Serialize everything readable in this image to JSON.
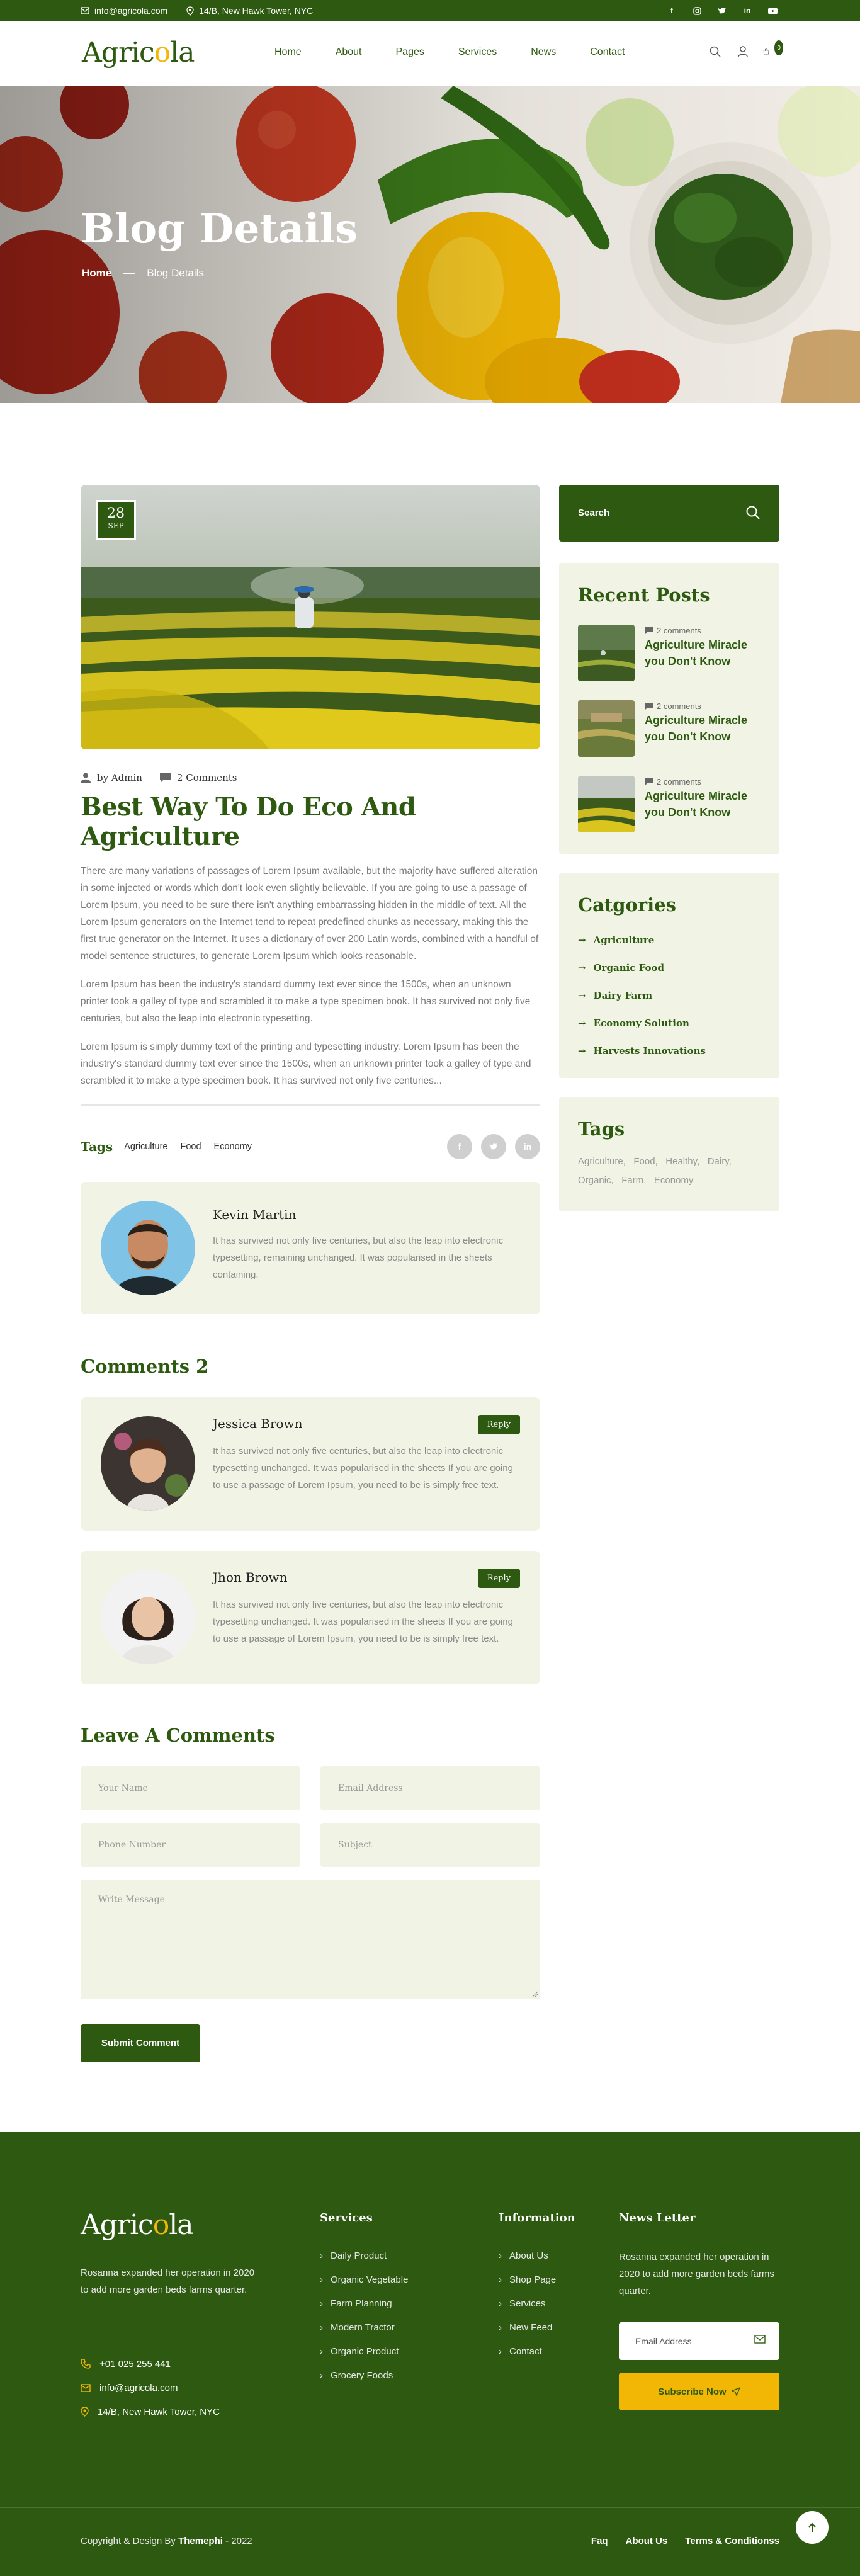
{
  "topbar": {
    "email": "info@agricola.com",
    "address": "14/B, New Hawk Tower, NYC",
    "social": [
      "facebook-icon",
      "instagram-icon",
      "twitter-icon",
      "linkedin-icon",
      "youtube-icon"
    ]
  },
  "header": {
    "logo_prefix": "Agric",
    "logo_o": "o",
    "logo_suffix": "la",
    "nav": [
      "Home",
      "About",
      "Pages",
      "Services",
      "News",
      "Contact"
    ],
    "cart_count": "0"
  },
  "hero": {
    "title": "Blog Details",
    "crumb_home": "Home",
    "crumb_current": "Blog Details"
  },
  "post": {
    "day": "28",
    "month": "SEP",
    "author": "by Admin",
    "comments": "2 Comments",
    "title": "Best Way To Do Eco And Agriculture",
    "paragraphs": [
      "There are many variations of passages of Lorem Ipsum available, but the majority have suffered alteration in some injected or words which don't look even slightly believable. If you are going to use a passage of Lorem Ipsum, you need to be sure there isn't anything embarrassing hidden in the middle of text. All the Lorem Ipsum generators on the Internet tend to repeat predefined chunks as necessary, making this the first true generator on the Internet. It uses a dictionary of over 200 Latin words, combined with a handful of model sentence structures, to generate Lorem Ipsum which looks reasonable.",
      "Lorem Ipsum has been the industry's standard dummy text ever since the 1500s, when an unknown printer took a galley of type and scrambled it to make a type specimen book. It has survived not only five centuries, but also the leap into electronic typesetting.",
      "Lorem Ipsum is simply dummy text of the printing and typesetting industry. Lorem Ipsum has been the industry's standard dummy text ever since the 1500s, when an unknown printer took a galley of type and scrambled it to make a type specimen book. It has survived not only five centuries..."
    ],
    "tags_label": "Tags",
    "tags": [
      "Agriculture",
      "Food",
      "Economy"
    ],
    "share": [
      "f",
      "t",
      "in"
    ]
  },
  "author_box": {
    "name": "Kevin Martin",
    "bio": "It has survived not only five centuries, but also the leap into electronic typesetting, remaining unchanged. It was popularised in the sheets containing."
  },
  "comments": {
    "heading": "Comments 2",
    "items": [
      {
        "name": "Jessica Brown",
        "reply": "Reply",
        "text": "It has survived not only five centuries, but also the leap into electronic typesetting unchanged. It was popularised in the sheets If you are going to use a passage of Lorem Ipsum, you need to be is simply free text."
      },
      {
        "name": "Jhon Brown",
        "reply": "Reply",
        "text": "It has survived not only five centuries, but also the leap into electronic typesetting unchanged. It was popularised in the sheets If you are going to use a passage of Lorem Ipsum, you need to be is simply free text."
      }
    ]
  },
  "form": {
    "heading": "Leave A Comments",
    "name_placeholder": "Your Name",
    "email_placeholder": "Email Address",
    "phone_placeholder": "Phone Number",
    "subject_placeholder": "Subject",
    "message_placeholder": "Write Message",
    "submit": "Submit Comment"
  },
  "sidebar": {
    "search_label": "Search",
    "recent_heading": "Recent Posts",
    "recent": [
      {
        "comments": "2 comments",
        "title": "Agriculture Miracle you Don't Know"
      },
      {
        "comments": "2 comments",
        "title": "Agriculture Miracle you Don't Know"
      },
      {
        "comments": "2 comments",
        "title": "Agriculture Miracle you Don't Know"
      }
    ],
    "categories_heading": "Catgories",
    "categories": [
      "Agriculture",
      "Organic Food",
      "Dairy Farm",
      "Economy Solution",
      "Harvests Innovations"
    ],
    "tags_heading": "Tags",
    "tags": [
      "Agriculture,",
      "Food,",
      "Healthy,",
      "Dairy,",
      "Organic,",
      "Farm,",
      "Economy"
    ]
  },
  "footer": {
    "desc": "Rosanna expanded her operation in 2020 to add more garden beds farms quarter.",
    "phone": "+01 025 255 441",
    "email": "info@agricola.com",
    "address": "14/B, New Hawk Tower, NYC",
    "services_heading": "Services",
    "services": [
      "Daily Product",
      "Organic Vegetable",
      "Farm Planning",
      "Modern Tractor",
      "Organic Product",
      "Grocery Foods"
    ],
    "info_heading": "Information",
    "info": [
      "About Us",
      "Shop Page",
      "Services",
      "New Feed",
      "Contact"
    ],
    "news_heading": "News Letter",
    "news_desc": "Rosanna expanded her operation in 2020 to add more garden beds farms quarter.",
    "email_placeholder": "Email Address",
    "subscribe": "Subscribe Now",
    "copyright_prefix": "Copyright & Design By",
    "copyright_brand": "Themephi",
    "copyright_suffix": "- 2022",
    "bottom_links": [
      "Faq",
      "About Us",
      "Terms & Conditionss"
    ]
  },
  "colors": {
    "primary": "#2d5a10",
    "accent": "#f2b705",
    "panel": "#f1f3e4"
  }
}
